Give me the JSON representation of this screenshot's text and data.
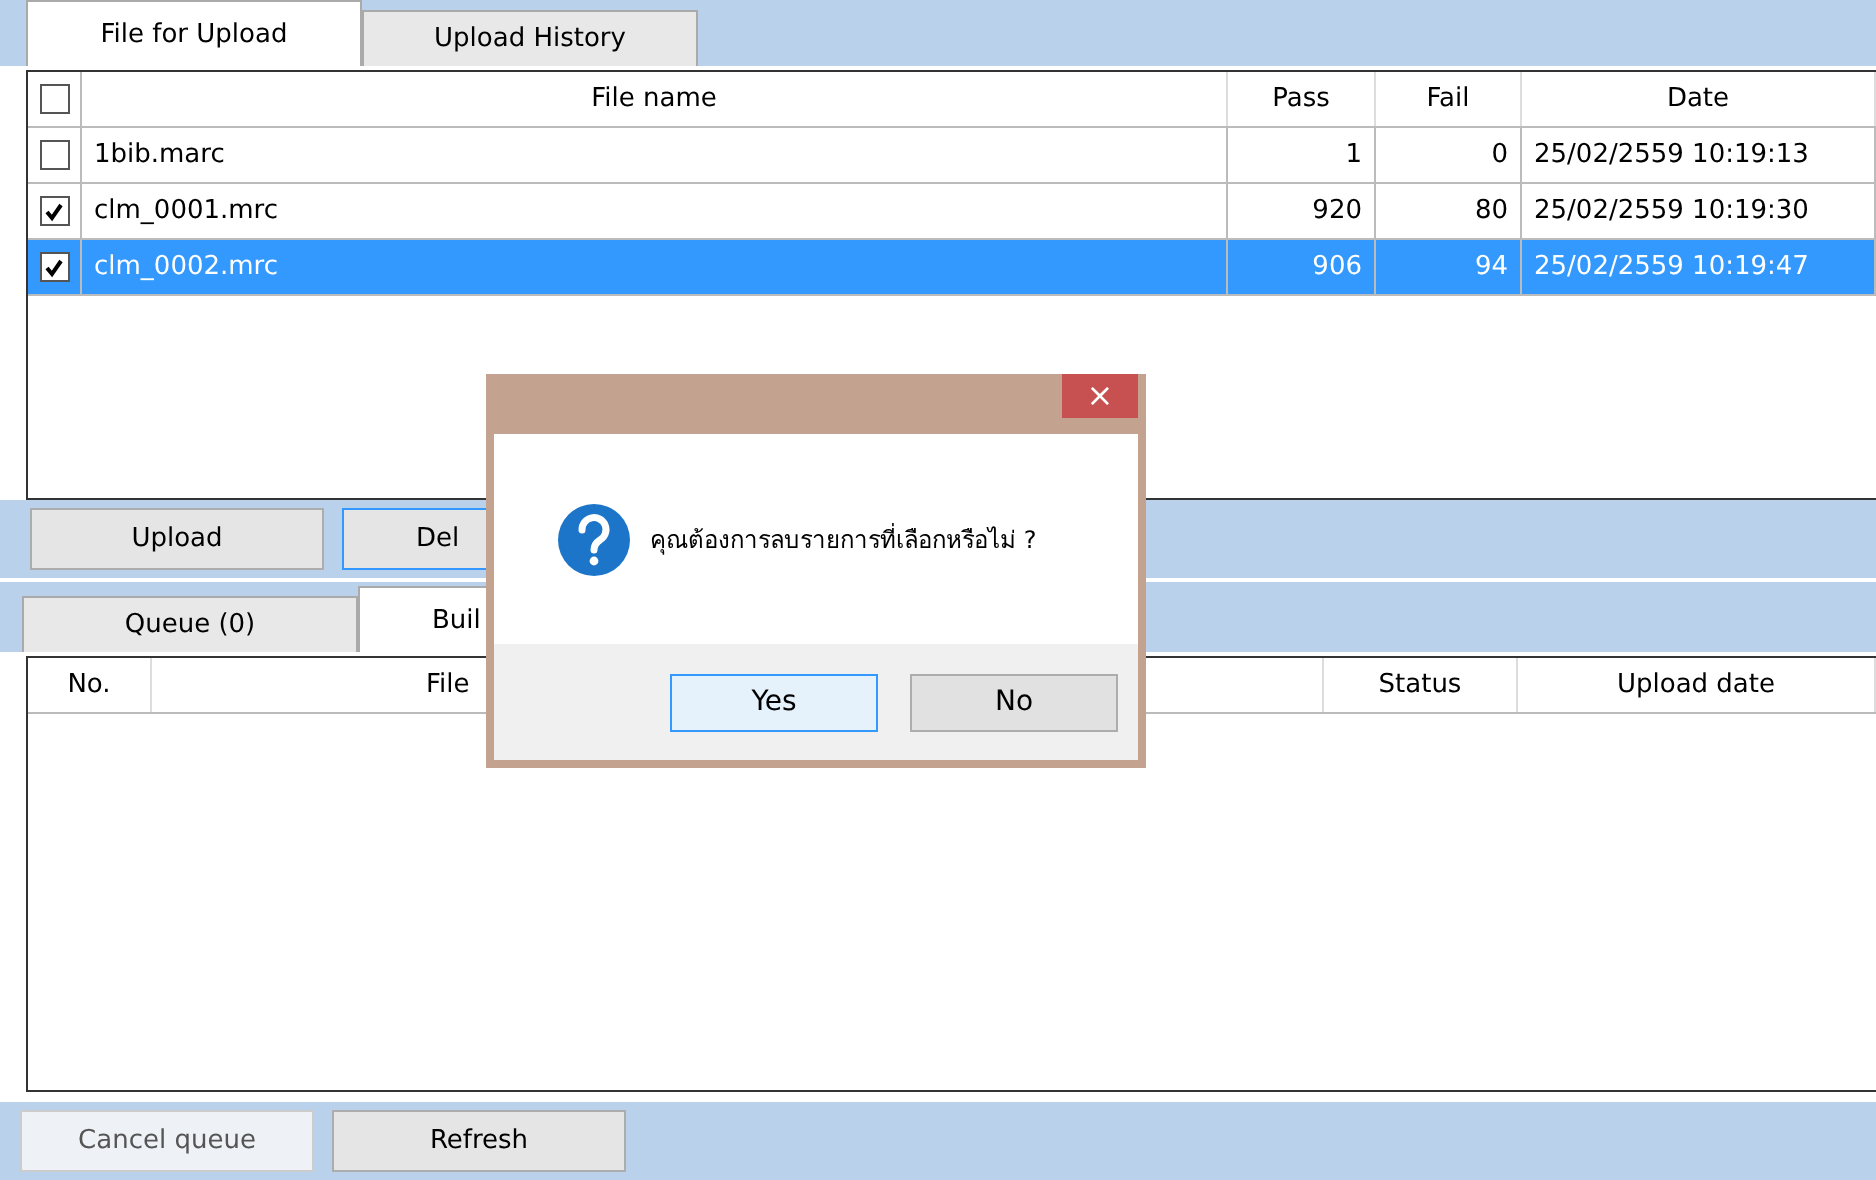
{
  "upload_tabs": [
    {
      "label": "File for Upload",
      "selected": true
    },
    {
      "label": "Upload History",
      "selected": false
    }
  ],
  "files_table": {
    "all_checked": false,
    "columns": [
      "File name",
      "Pass",
      "Fail",
      "Date"
    ],
    "rows": [
      {
        "checked": false,
        "selected": false,
        "file_name": "1bib.marc",
        "pass": "1",
        "fail": "0",
        "date": "25/02/2559 10:19:13"
      },
      {
        "checked": true,
        "selected": false,
        "file_name": "clm_0001.mrc",
        "pass": "920",
        "fail": "80",
        "date": "25/02/2559 10:19:30"
      },
      {
        "checked": true,
        "selected": true,
        "file_name": "clm_0002.mrc",
        "pass": "906",
        "fail": "94",
        "date": "25/02/2559 10:19:47"
      }
    ]
  },
  "file_buttons": [
    {
      "label": "Upload",
      "disabled": false
    },
    {
      "label": "Del",
      "disabled": false
    }
  ],
  "queue_tabs": [
    {
      "label": "Queue (0)",
      "selected": false
    },
    {
      "label": "Buil",
      "selected": true
    }
  ],
  "queue_table": {
    "columns": [
      "No.",
      "File",
      "Status",
      "Upload date"
    ]
  },
  "queue_buttons": [
    {
      "label": "Cancel queue",
      "disabled": true
    },
    {
      "label": "Refresh",
      "disabled": false
    }
  ],
  "dialog": {
    "close": "×",
    "message": "คุณต้องการลบรายการที่เลือกหรือไม่ ?",
    "buttons": [
      {
        "label": "Yes",
        "selected": true
      },
      {
        "label": "No",
        "selected": false
      }
    ]
  }
}
